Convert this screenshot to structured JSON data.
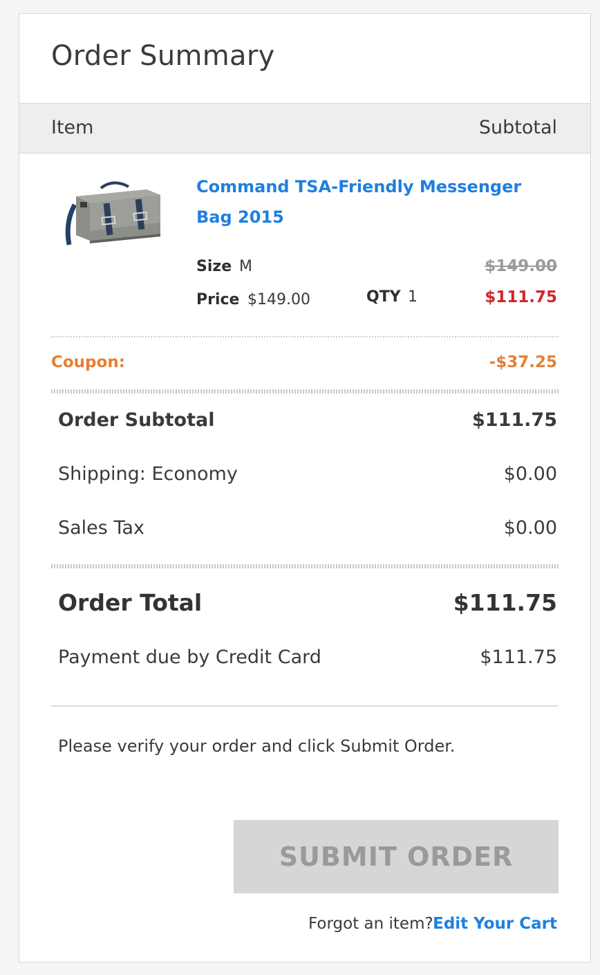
{
  "title": "Order Summary",
  "columns": {
    "item": "Item",
    "subtotal": "Subtotal"
  },
  "product": {
    "name": "Command TSA-Friendly Messenger Bag 2015",
    "thumbnail_icon": "messenger-bag-image",
    "size_label": "Size",
    "size_value": "M",
    "price_label": "Price",
    "price_value": "$149.00",
    "qty_label": "QTY",
    "qty_value": "1",
    "original_subtotal": "$149.00",
    "discounted_subtotal": "$111.75"
  },
  "coupon": {
    "label": "Coupon:",
    "value": "-$37.25"
  },
  "totals": {
    "order_subtotal_label": "Order Subtotal",
    "order_subtotal_value": "$111.75",
    "shipping_label": "Shipping: Economy",
    "shipping_value": "$0.00",
    "tax_label": "Sales Tax",
    "tax_value": "$0.00",
    "order_total_label": "Order Total",
    "order_total_value": "$111.75",
    "payment_label": "Payment due by Credit Card",
    "payment_value": "$111.75"
  },
  "verify_text": "Please verify your order and click Submit Order.",
  "submit_label": "SUBMIT ORDER",
  "footer": {
    "forgot_text": "Forgot an item?",
    "edit_cart_label": "Edit Your Cart"
  },
  "colors": {
    "link": "#1f7fe0",
    "sale_price": "#d0262a",
    "coupon": "#e77f35",
    "button_disabled": "#d6d6d6"
  }
}
